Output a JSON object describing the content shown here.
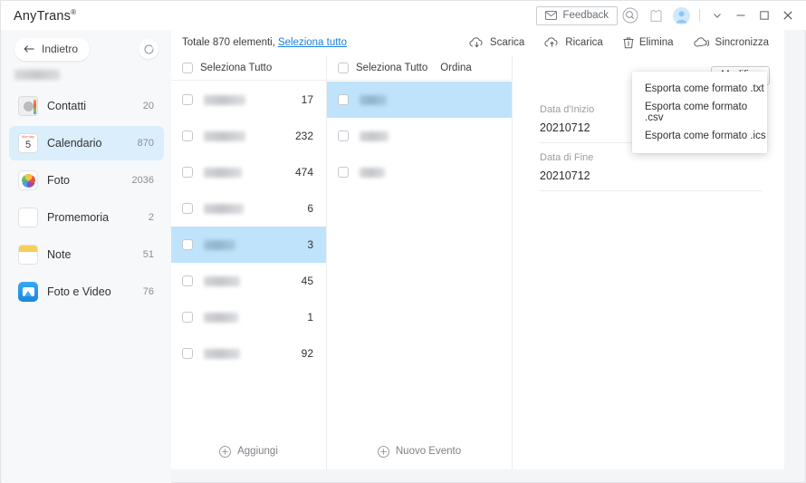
{
  "titlebar": {
    "brand": "AnyTrans",
    "brand_mark": "®",
    "feedback_label": "Feedback",
    "icons": {
      "search": "search-icon",
      "gift": "shirt-icon",
      "avatar": "avatar-icon",
      "chevron": "chevron-down-icon",
      "minimize": "minimize-icon",
      "maximize": "maximize-icon",
      "close": "close-icon"
    }
  },
  "sidebar": {
    "back_label": "Indietro",
    "refresh_label": "refresh-icon",
    "device_name": "",
    "items": [
      {
        "label": "Contatti",
        "count": "20",
        "icon": "contacts-icon"
      },
      {
        "label": "Calendario",
        "count": "870",
        "icon": "calendar-icon",
        "day": "5",
        "weekday": "Monday"
      },
      {
        "label": "Foto",
        "count": "2036",
        "icon": "photos-icon"
      },
      {
        "label": "Promemoria",
        "count": "2",
        "icon": "reminders-icon"
      },
      {
        "label": "Note",
        "count": "51",
        "icon": "notes-icon"
      },
      {
        "label": "Foto e Video",
        "count": "76",
        "icon": "photos-videos-icon"
      }
    ]
  },
  "topbar": {
    "total_text": "Totale 870 elementi,",
    "select_all_link": "Seleziona tutto",
    "tools": [
      {
        "label": "Scarica",
        "icon": "download-icon"
      },
      {
        "label": "Ricarica",
        "icon": "upload-icon"
      },
      {
        "label": "Elimina",
        "icon": "trash-icon"
      },
      {
        "label": "Sincronizza",
        "icon": "sync-icon"
      }
    ]
  },
  "context_menu": {
    "items": [
      "Esporta come formato .txt",
      "Esporta come formato .csv",
      "Esporta come formato .ics"
    ]
  },
  "calendar_list": {
    "header_label": "Seleziona Tutto",
    "add_label": "Aggiungi",
    "rows": [
      {
        "name": "",
        "count": "17",
        "selected": false,
        "w": 46
      },
      {
        "name": "",
        "count": "232",
        "selected": false,
        "w": 46
      },
      {
        "name": "",
        "count": "474",
        "selected": false,
        "w": 42
      },
      {
        "name": "",
        "count": "6",
        "selected": false,
        "w": 44
      },
      {
        "name": "",
        "count": "3",
        "selected": true,
        "w": 35
      },
      {
        "name": "",
        "count": "45",
        "selected": false,
        "w": 40
      },
      {
        "name": "",
        "count": "1",
        "selected": false,
        "w": 38
      },
      {
        "name": "",
        "count": "92",
        "selected": false,
        "w": 40
      }
    ]
  },
  "event_list": {
    "header_label": "Seleziona Tutto",
    "sort_label": "Ordina",
    "new_label": "Nuovo Evento",
    "rows": [
      {
        "name": "",
        "selected": true,
        "w": 30
      },
      {
        "name": "",
        "selected": false,
        "w": 32
      },
      {
        "name": "",
        "selected": false,
        "w": 28
      }
    ]
  },
  "detail": {
    "edit_label": "Modifica",
    "fields": [
      {
        "label": "Data d'Inizio",
        "value": "20210712"
      },
      {
        "label": "Data di Fine",
        "value": "20210712"
      }
    ]
  },
  "colors": {
    "accent": "#1a7fe0",
    "selection": "#bfe3fa",
    "sidebar_active": "#dbeefc",
    "page_bg": "#f4f5f7"
  }
}
